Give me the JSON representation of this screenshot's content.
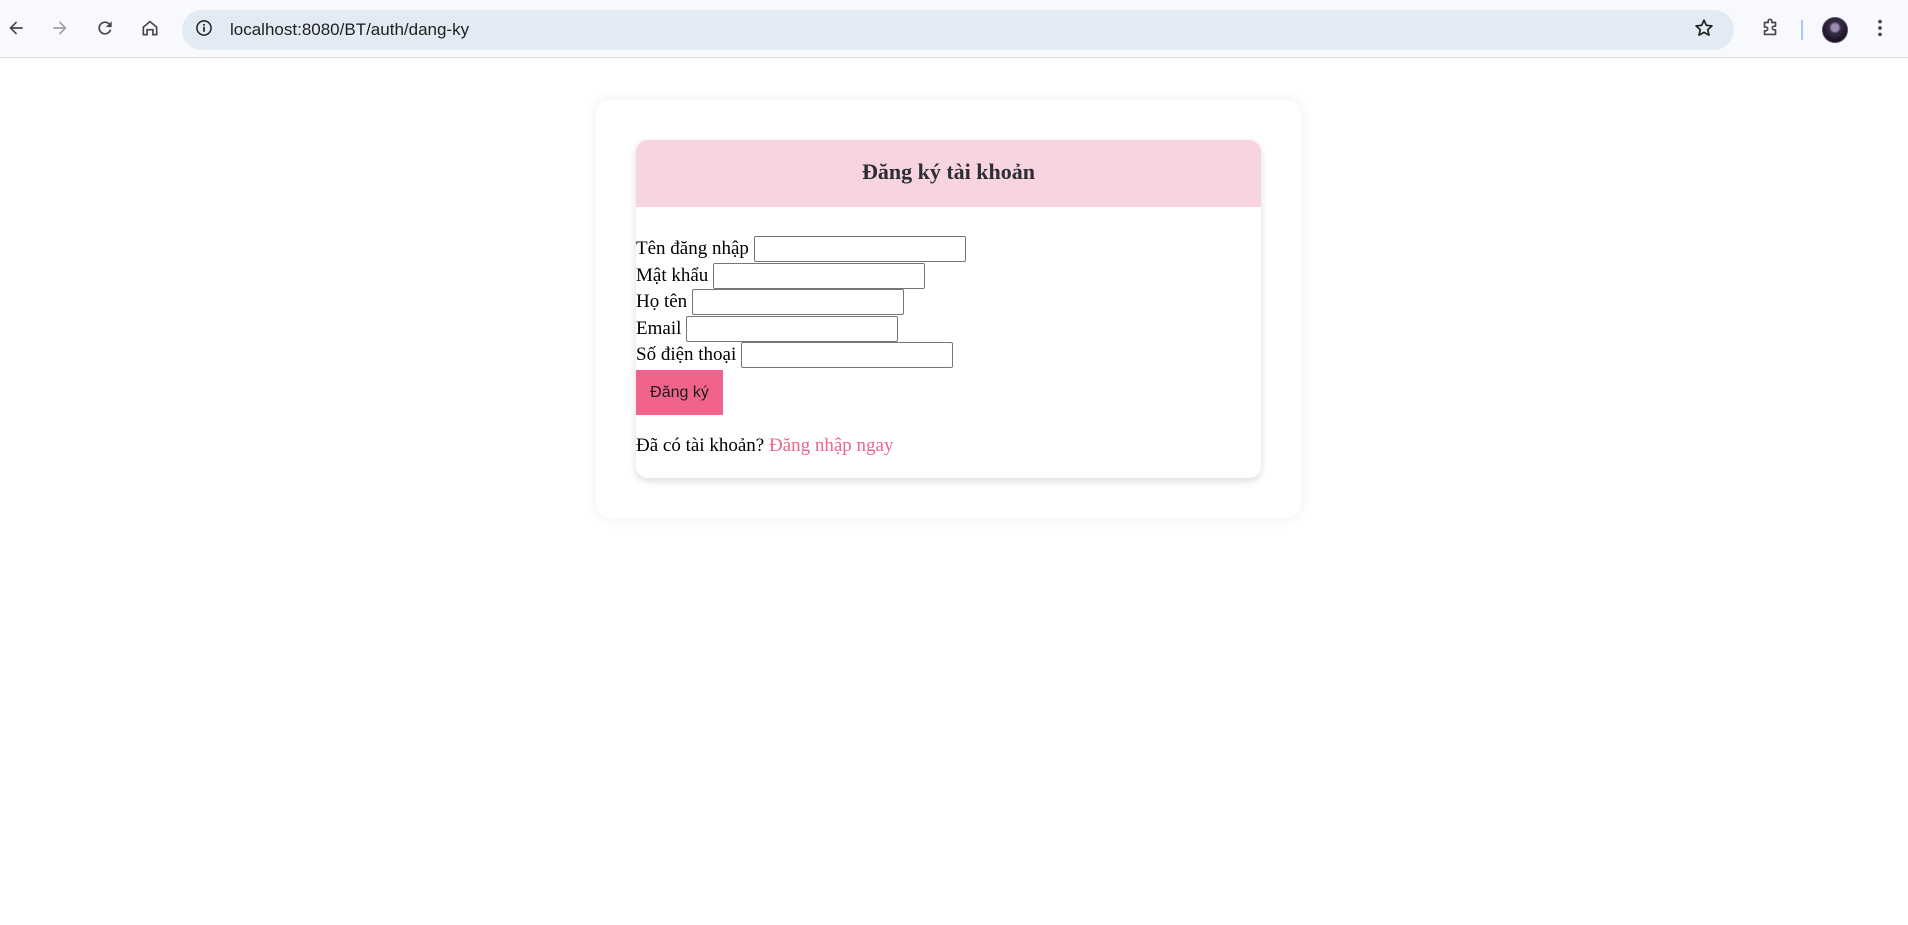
{
  "browser": {
    "url": "localhost:8080/BT/auth/dang-ky",
    "icons": {
      "back": "arrow-left-icon",
      "forward": "arrow-right-icon",
      "reload": "reload-icon",
      "home": "home-icon",
      "site_info": "info-icon",
      "bookmark": "star-icon",
      "extensions": "puzzle-icon",
      "profile": "avatar",
      "menu": "more-vertical-icon"
    },
    "colors": {
      "toolbar": "#f8f9fc",
      "omnibox": "#e2ebf3"
    }
  },
  "form": {
    "title": "Đăng ký tài khoản",
    "fields": [
      {
        "label": "Tên đăng nhập",
        "value": ""
      },
      {
        "label": "Mật khẩu",
        "value": ""
      },
      {
        "label": "Họ tên",
        "value": ""
      },
      {
        "label": "Email",
        "value": ""
      },
      {
        "label": "Số điện thoại",
        "value": ""
      }
    ],
    "submit_label": "Đăng ký",
    "login_prompt": "Đã có tài khoản?",
    "login_link": "Đăng nhập ngay",
    "colors": {
      "header_bg": "#f7d4df",
      "accent": "#f0648c"
    }
  }
}
